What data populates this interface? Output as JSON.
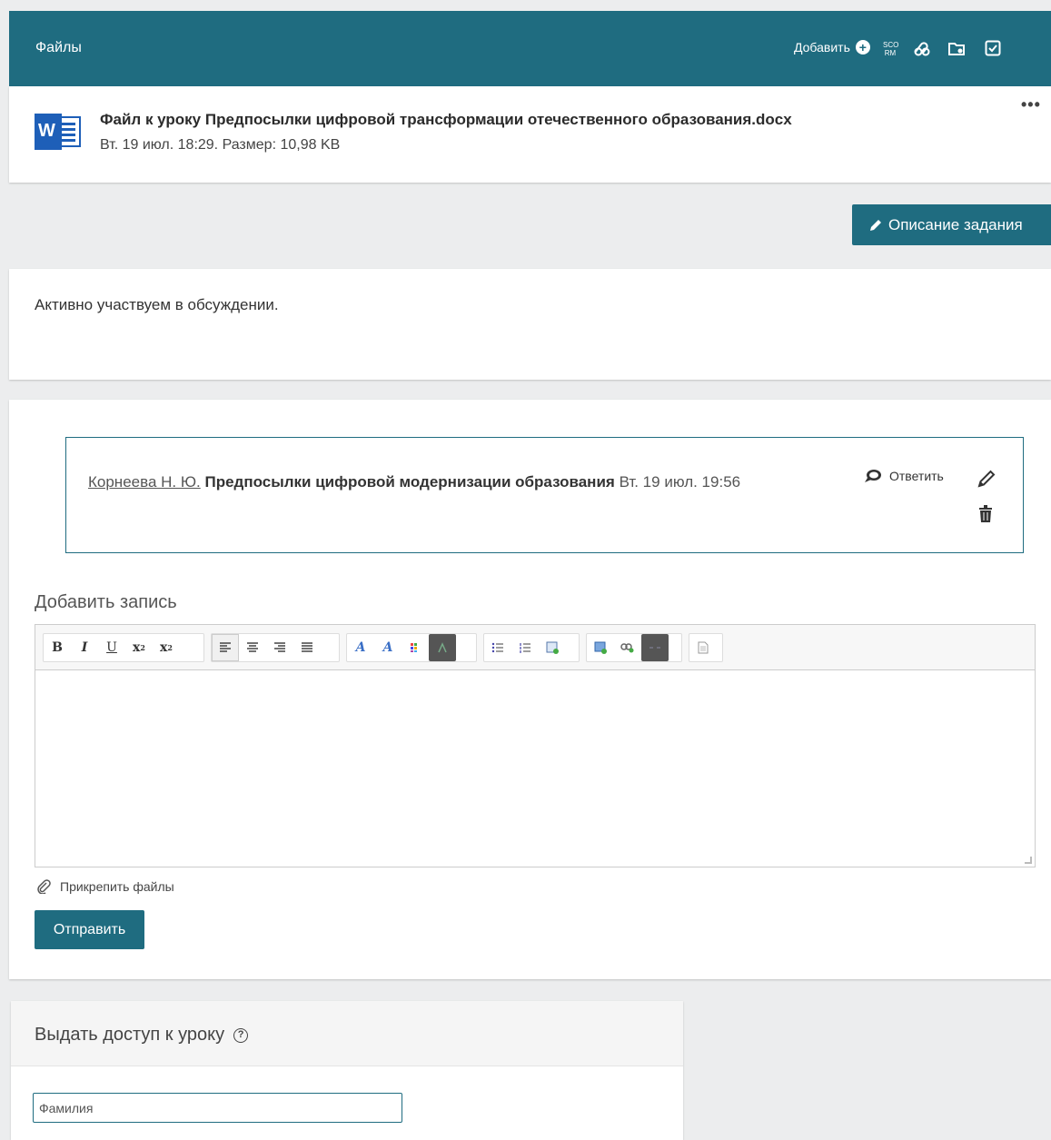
{
  "header": {
    "title": "Файлы",
    "add_label": "Добавить",
    "sco_label_top": "SCO",
    "sco_label_bottom": "RM"
  },
  "file": {
    "name": "Файл к уроку Предпосылки цифровой трансформации отечественного образования.docx",
    "meta": "Вт. 19 июл. 18:29. Размер: 10,98 KB",
    "more": "•••",
    "app_letter": "W"
  },
  "description_button": "Описание задания",
  "task": {
    "text": "Активно участвуем в обсуждении."
  },
  "comment": {
    "author": "Корнеева Н. Ю.",
    "title": "Предпосылки цифровой модернизации образования",
    "date": "Вт. 19 июл. 19:56",
    "reply_label": "Ответить"
  },
  "composer": {
    "title": "Добавить запись",
    "attach_label": "Прикрепить файлы",
    "send_label": "Отправить"
  },
  "access": {
    "title": "Выдать доступ к уроку",
    "help": "?",
    "surname_placeholder": "Фамилия"
  },
  "colors": {
    "accent": "#1f6c80",
    "background": "#ecedee",
    "word_blue": "#1e5fb8"
  }
}
